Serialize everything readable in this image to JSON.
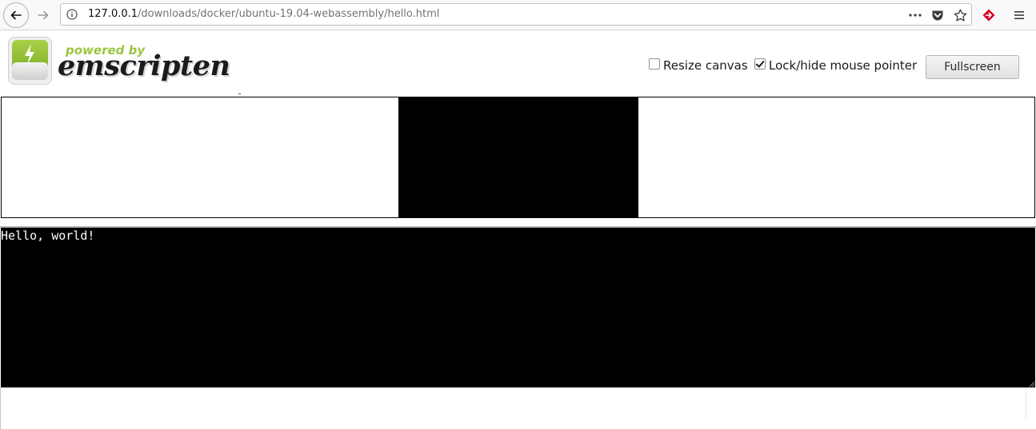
{
  "browser": {
    "url_host": "127.0.0.1",
    "url_path": "/downloads/docker/ubuntu-19.04-webassembly/hello.html",
    "icons": {
      "back": "back-arrow-icon",
      "forward": "forward-arrow-icon",
      "info": "info-icon",
      "page_actions": "more-horizontal-icon",
      "pocket": "pocket-icon",
      "bookmark": "star-icon",
      "extension": "extension-icon",
      "menu": "hamburger-menu-icon"
    }
  },
  "header": {
    "powered_by": "powered by",
    "brand": "emscripten",
    "resize_canvas_label": "Resize canvas",
    "resize_canvas_checked": false,
    "lock_pointer_label": "Lock/hide mouse pointer",
    "lock_pointer_checked": true,
    "fullscreen_label": "Fullscreen"
  },
  "output": {
    "text": "Hello, world!"
  },
  "colors": {
    "logo_green": "#9cc543",
    "canvas_bg": "#000000",
    "output_bg": "#000000",
    "output_fg": "#ffffff",
    "extension_red": "#d70022"
  }
}
